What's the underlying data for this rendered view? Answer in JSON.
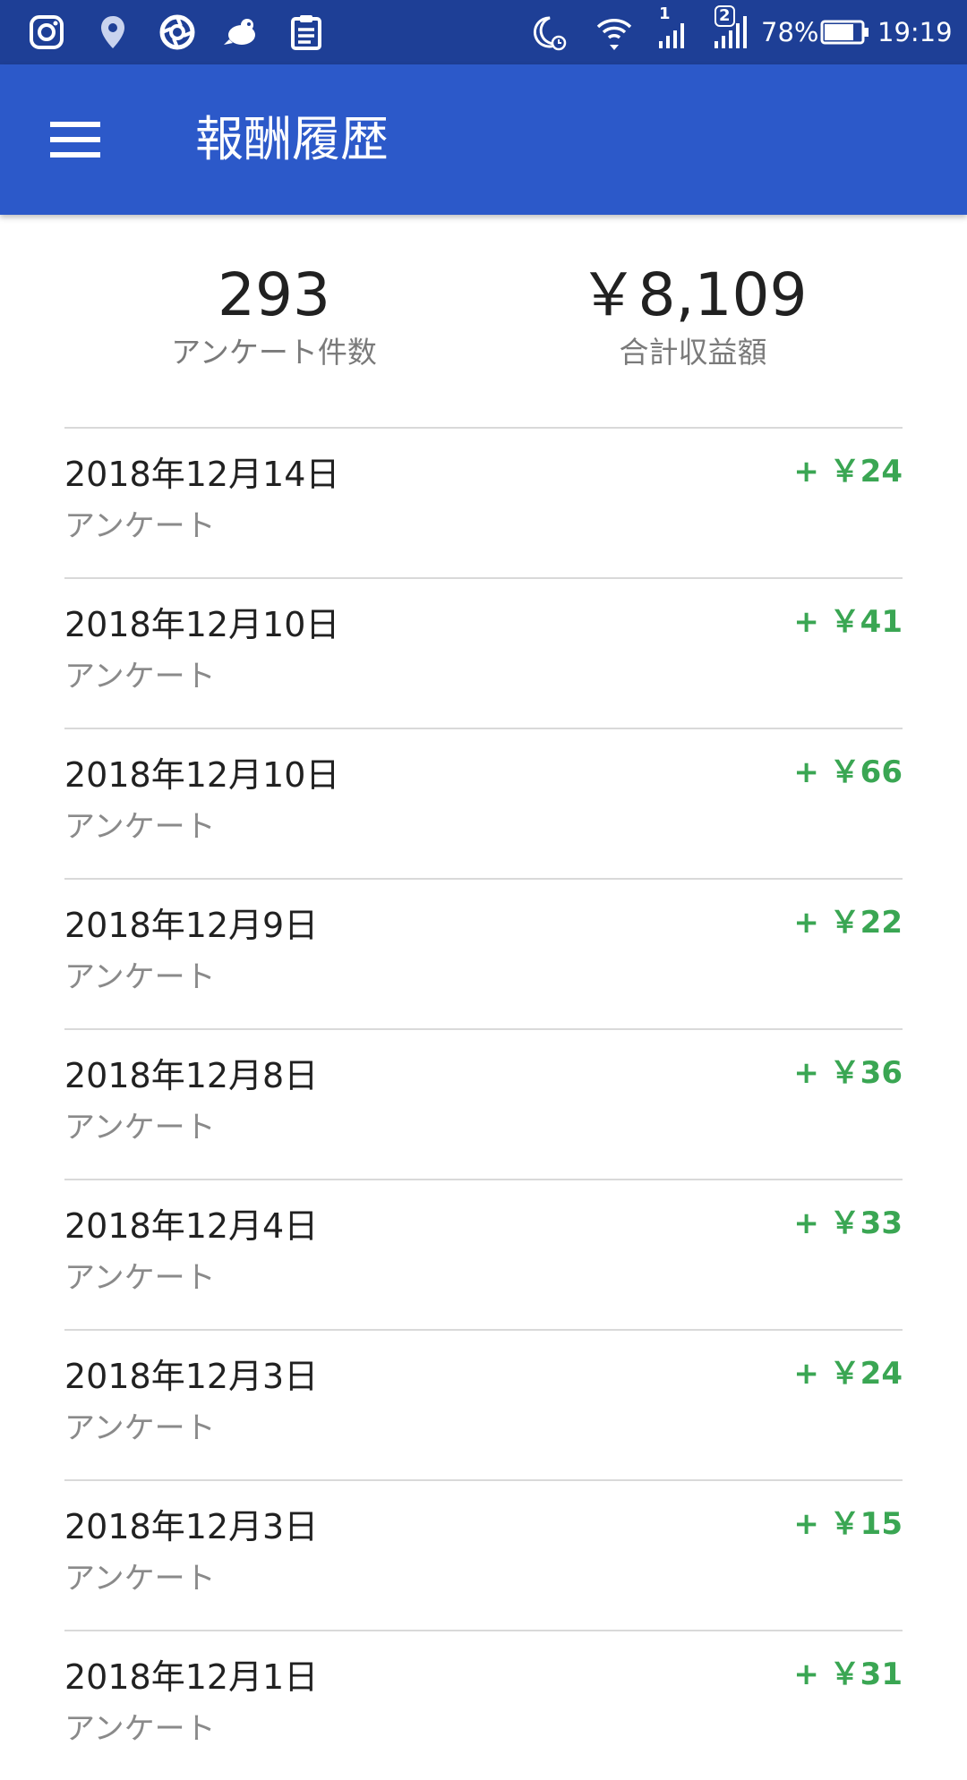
{
  "status_bar": {
    "left_icons": [
      "instagram-icon",
      "location-pin-icon",
      "aperture-icon",
      "bird-icon",
      "clipboard-icon"
    ],
    "right_icons": [
      "moon-alarm-icon",
      "wifi-icon",
      "signal-sim1-icon",
      "signal-sim2-icon",
      "battery-icon"
    ],
    "sim1_label": "1",
    "sim2_label": "2",
    "battery_percent": "78%",
    "battery_level": 0.78,
    "time": "19:19",
    "background_color": "#1e3f96"
  },
  "app_bar": {
    "title": "報酬履歴",
    "menu_icon": "hamburger-menu-icon",
    "background_color": "#2c59c9"
  },
  "summary": {
    "survey_count": "293",
    "survey_count_label": "アンケート件数",
    "total_earnings": "￥8,109",
    "total_earnings_label": "合計収益額"
  },
  "history": {
    "amount_color": "#3aa653",
    "items": [
      {
        "date": "2018年12月14日",
        "type": "アンケート",
        "amount": "+ ￥24"
      },
      {
        "date": "2018年12月10日",
        "type": "アンケート",
        "amount": "+ ￥41"
      },
      {
        "date": "2018年12月10日",
        "type": "アンケート",
        "amount": "+ ￥66"
      },
      {
        "date": "2018年12月9日",
        "type": "アンケート",
        "amount": "+ ￥22"
      },
      {
        "date": "2018年12月8日",
        "type": "アンケート",
        "amount": "+ ￥36"
      },
      {
        "date": "2018年12月4日",
        "type": "アンケート",
        "amount": "+ ￥33"
      },
      {
        "date": "2018年12月3日",
        "type": "アンケート",
        "amount": "+ ￥24"
      },
      {
        "date": "2018年12月3日",
        "type": "アンケート",
        "amount": "+ ￥15"
      },
      {
        "date": "2018年12月1日",
        "type": "アンケート",
        "amount": "+ ￥31"
      }
    ]
  }
}
